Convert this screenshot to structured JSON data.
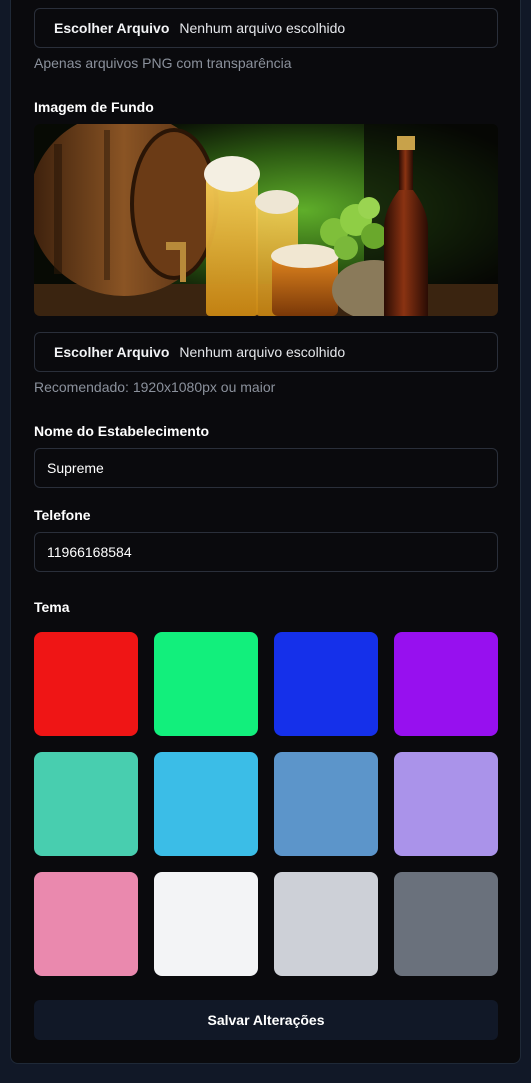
{
  "logo_upload": {
    "button_label": "Escolher Arquivo",
    "status": "Nenhum arquivo escolhido",
    "hint": "Apenas arquivos PNG com transparência"
  },
  "background": {
    "label": "Imagem de Fundo",
    "button_label": "Escolher Arquivo",
    "status": "Nenhum arquivo escolhido",
    "hint": "Recomendado: 1920x1080px ou maior"
  },
  "establishment": {
    "label": "Nome do Estabelecimento",
    "value": "Supreme"
  },
  "phone": {
    "label": "Telefone",
    "value": "11966168584"
  },
  "theme": {
    "label": "Tema",
    "colors": [
      "#ef1515",
      "#12ef7c",
      "#1530ea",
      "#9710ef",
      "#48ceaf",
      "#3bbde7",
      "#5c95ca",
      "#aa93ea",
      "#ea89ae",
      "#f3f4f6",
      "#cdd0d7",
      "#6a717c"
    ]
  },
  "save_label": "Salvar Alterações"
}
